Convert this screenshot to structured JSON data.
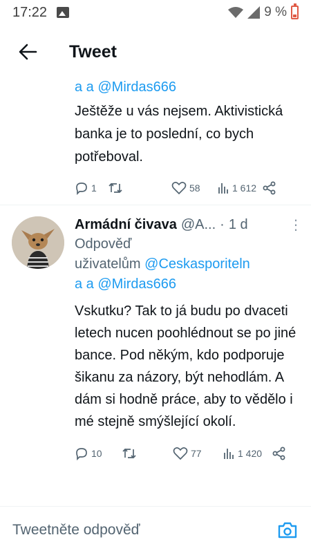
{
  "status_bar": {
    "time": "17:22",
    "battery": "9 %"
  },
  "header": {
    "title": "Tweet"
  },
  "previous_reply": {
    "mentions": "a a @Mirdas666",
    "text": "Ještěže u vás nejsem. Aktivistická banka je to poslední, co bych potřeboval.",
    "replies": "1",
    "likes": "58",
    "views": "1 612"
  },
  "main_tweet": {
    "display_name": "Armádní čivava",
    "handle": "@A...",
    "dot": "·",
    "time": "1 d",
    "more": "⋮",
    "reply_label": "Odpověď",
    "reply_to_prefix": "uživatelům",
    "reply_to_account": "@Ceskasporiteln",
    "reply_to_account_cont": "a a @Mirdas666",
    "text": "Vskutku? Tak to já budu po dvaceti letech nucen poohlédnout se po jiné bance. Pod někým, kdo podporuje šikanu za názory, být nehodlám. A dám si hodně práce, aby to vědělo i mé stejně smýšlející okolí.",
    "replies": "10",
    "likes": "77",
    "views": "1 420"
  },
  "compose": {
    "placeholder": "Tweetněte odpověď"
  },
  "colors": {
    "accent": "#1d9bf0",
    "secondary_text": "#536471"
  }
}
